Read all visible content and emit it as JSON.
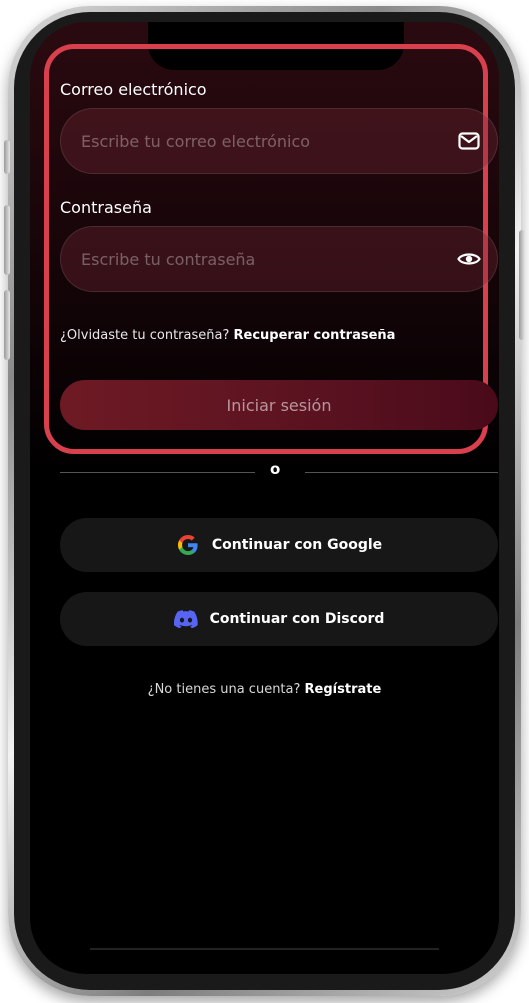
{
  "form": {
    "email_label": "Correo electrónico",
    "email_placeholder": "Escribe tu correo electrónico",
    "email_icon": "mail-icon",
    "password_label": "Contraseña",
    "password_placeholder": "Escribe tu contraseña",
    "password_icon": "eye-icon",
    "forgot_text": "¿Olvidaste tu contraseña?",
    "forgot_link": "Recuperar contraseña",
    "login_button": "Iniciar sesión"
  },
  "divider": {
    "text": "o"
  },
  "social": {
    "google_button": "Continuar con Google",
    "google_icon": "google-icon",
    "discord_button": "Continuar con Discord",
    "discord_icon": "discord-icon"
  },
  "register": {
    "text": "¿No tienes una cuenta?",
    "link": "Regístrate"
  },
  "colors": {
    "highlight_border": "#d8404e",
    "discord_brand": "#5865f2",
    "background": "#000000"
  }
}
